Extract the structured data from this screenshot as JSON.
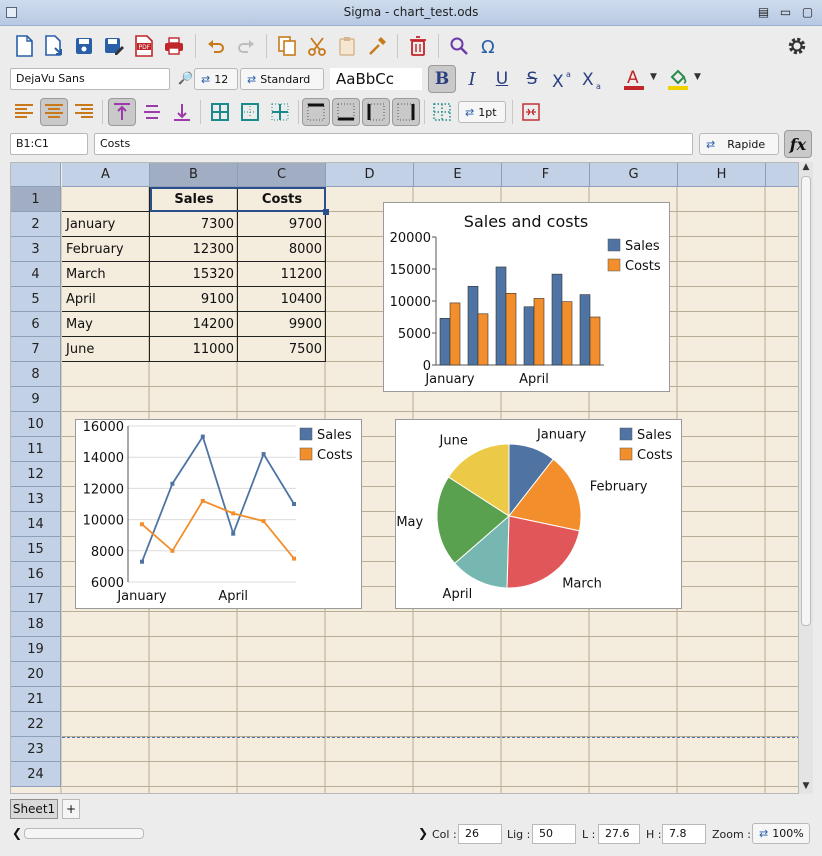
{
  "window": {
    "title": "Sigma - chart_test.ods"
  },
  "font_bar": {
    "font_name": "DejaVu Sans",
    "font_size": "12",
    "style_name": "Standard",
    "preview_text": "AaBbCc",
    "bold_label": "B",
    "italic_label": "I",
    "underline_label": "U",
    "strike_label": "S"
  },
  "format_bar": {
    "border_width": "1pt"
  },
  "formula_bar": {
    "cell_ref": "B1:C1",
    "content": "Costs",
    "mode": "Rapide",
    "fx_label": "fx"
  },
  "columns": [
    "A",
    "B",
    "C",
    "D",
    "E",
    "F",
    "G",
    "H"
  ],
  "rows": [
    "1",
    "2",
    "3",
    "4",
    "5",
    "6",
    "7",
    "8",
    "9",
    "10",
    "11",
    "12",
    "13",
    "14",
    "15",
    "16",
    "17",
    "18",
    "19",
    "20",
    "21",
    "22",
    "23",
    "24"
  ],
  "table": {
    "headers": [
      "Sales",
      "Costs"
    ],
    "rows": [
      {
        "month": "January",
        "sales": "7300",
        "costs": "9700"
      },
      {
        "month": "February",
        "sales": "12300",
        "costs": "8000"
      },
      {
        "month": "March",
        "sales": "15320",
        "costs": "11200"
      },
      {
        "month": "April",
        "sales": "9100",
        "costs": "10400"
      },
      {
        "month": "May",
        "sales": "14200",
        "costs": "9900"
      },
      {
        "month": "June",
        "sales": "11000",
        "costs": "7500"
      }
    ]
  },
  "chart_data": [
    {
      "type": "bar",
      "title": "Sales and costs",
      "categories": [
        "January",
        "February",
        "March",
        "April",
        "May",
        "June"
      ],
      "tick_labels_x": [
        "January",
        "April"
      ],
      "series": [
        {
          "name": "Sales",
          "values": [
            7300,
            12300,
            15320,
            9100,
            14200,
            11000
          ]
        },
        {
          "name": "Costs",
          "values": [
            9700,
            8000,
            11200,
            10400,
            9900,
            7500
          ]
        }
      ],
      "ylim": [
        0,
        20000
      ],
      "yticks": [
        "0",
        "5000",
        "10000",
        "15000",
        "20000"
      ],
      "legend": "top-right",
      "grid": false
    },
    {
      "type": "line",
      "title": "",
      "categories": [
        "January",
        "February",
        "March",
        "April",
        "May",
        "June"
      ],
      "tick_labels_x": [
        "January",
        "April"
      ],
      "series": [
        {
          "name": "Sales",
          "values": [
            7300,
            12300,
            15320,
            9100,
            14200,
            11000
          ]
        },
        {
          "name": "Costs",
          "values": [
            9700,
            8000,
            11200,
            10400,
            9900,
            7500
          ]
        }
      ],
      "ylim": [
        6000,
        16000
      ],
      "yticks": [
        "6000",
        "8000",
        "10000",
        "12000",
        "14000",
        "16000"
      ],
      "legend": "top-right",
      "grid": true
    },
    {
      "type": "pie",
      "title": "",
      "categories": [
        "January",
        "February",
        "March",
        "April",
        "May",
        "June"
      ],
      "series": [
        {
          "name": "Sales",
          "values": [
            7300,
            12300,
            15320,
            9100,
            14200,
            11000
          ]
        }
      ],
      "legend_entries": [
        "Sales",
        "Costs"
      ],
      "legend": "top-right"
    }
  ],
  "colors": {
    "sales": "#4f74a3",
    "costs": "#f28e2b",
    "pie": [
      "#4f74a3",
      "#f28e2b",
      "#e15759",
      "#76b7b2",
      "#59a14f",
      "#edc948"
    ]
  },
  "sheet_tabs": {
    "active": "Sheet1",
    "add": "+"
  },
  "status": {
    "col_label": "Col :",
    "col_value": "26",
    "row_label": "Lig :",
    "row_value": "50",
    "width_label": "L :",
    "width_value": "27.6",
    "height_label": "H :",
    "height_value": "7.8",
    "zoom_label": "Zoom :",
    "zoom_value": "100%"
  }
}
